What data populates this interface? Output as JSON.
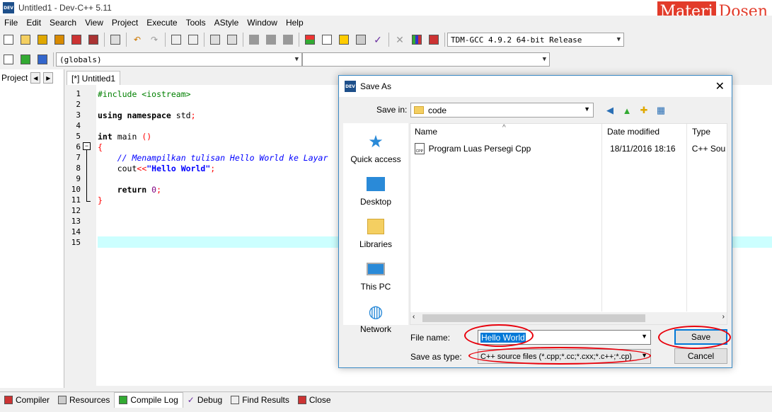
{
  "window": {
    "title": "Untitled1 - Dev-C++ 5.11",
    "icon_text": "DEV",
    "watermark": [
      "Materi",
      "Dosen"
    ]
  },
  "menu": [
    "File",
    "Edit",
    "Search",
    "View",
    "Project",
    "Execute",
    "Tools",
    "AStyle",
    "Window",
    "Help"
  ],
  "toolbar": {
    "compiler_select": "TDM-GCC 4.9.2 64-bit Release",
    "scope_select": "(globals)",
    "member_select": ""
  },
  "project_panel": {
    "tab_label": "Project"
  },
  "editor": {
    "tab_label": "[*] Untitled1",
    "line_numbers": [
      "1",
      "2",
      "3",
      "4",
      "5",
      "6",
      "7",
      "8",
      "9",
      "10",
      "11",
      "12",
      "13",
      "14",
      "15"
    ],
    "lines": {
      "l1": "#include <iostream>",
      "l3a": "using namespace",
      "l3b": " std",
      "l3c": ";",
      "l5a": "int",
      "l5b": " main ",
      "l5c": "()",
      "l6": "{",
      "l7": "    // Menampilkan tulisan Hello World ke Layar",
      "l8a": "    cout",
      "l8b": "<<",
      "l8c": "\"Hello World\"",
      "l8d": ";",
      "l10a": "    return",
      "l10b": " 0",
      "l10c": ";",
      "l11": "}"
    }
  },
  "bottom_tabs": [
    "Compiler",
    "Resources",
    "Compile Log",
    "Debug",
    "Find Results",
    "Close"
  ],
  "dialog": {
    "title": "Save As",
    "save_in_label": "Save in:",
    "save_in_value": "code",
    "places": [
      "Quick access",
      "Desktop",
      "Libraries",
      "This PC",
      "Network"
    ],
    "columns": [
      "Name",
      "Date modified",
      "Type"
    ],
    "files": [
      {
        "name": "Program Luas Persegi Cpp",
        "date": "18/11/2016 18:16",
        "type": "C++ Sour"
      }
    ],
    "file_name_label": "File name:",
    "file_name_value": "Hello World",
    "save_as_type_label": "Save as type:",
    "save_as_type_value": "C++ source files (*.cpp;*.cc;*.cxx;*.c++;*.cp)",
    "save_button": "Save",
    "cancel_button": "Cancel"
  },
  "colors": {
    "accent": "#0078d7",
    "annotation": "#e8000b",
    "watermark": "#e23b2a",
    "active_line": "#ccffff"
  }
}
